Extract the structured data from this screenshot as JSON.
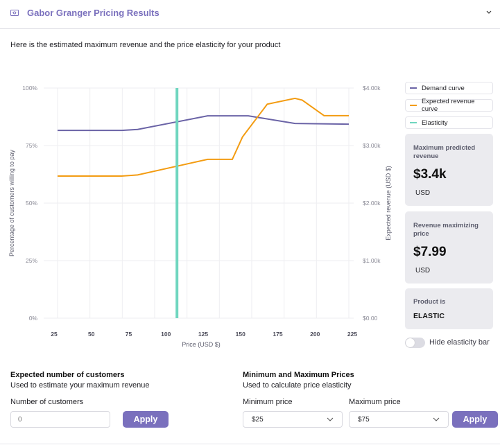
{
  "header": {
    "title": "Gabor Granger Pricing Results",
    "icon": "money-icon",
    "collapse_icon": "chevron-down-icon"
  },
  "intro_text": "Here is the estimated maximum revenue and the price elasticity for your product",
  "colors": {
    "brand": "#7a70bd",
    "demand": "#6a63a6",
    "revenue": "#f39c12",
    "elasticity": "#6fd6bf"
  },
  "chart_data": {
    "type": "line",
    "title": "",
    "xlabel": "Price (USD $)",
    "ylabel": "Percentage of customers willing to pay",
    "y2label": "Expected revenue (USD $)",
    "xlim": [
      25,
      225
    ],
    "ylim": [
      0,
      100
    ],
    "y2lim": [
      0,
      4000
    ],
    "x_ticks": [
      "25",
      "50",
      "75",
      "100",
      "125",
      "150",
      "175",
      "200",
      "225"
    ],
    "y_ticks": [
      "0%",
      "25%",
      "50%",
      "75%",
      "100%"
    ],
    "y2_ticks": [
      "$0.00",
      "$1.00k",
      "$2.00k",
      "$3.00k",
      "$4.00k"
    ],
    "grid": true,
    "legend": "right",
    "series": [
      {
        "name": "Demand curve",
        "axis": "left",
        "x": [
          25,
          69,
          80,
          128,
          156,
          188,
          225
        ],
        "values": [
          81.6,
          81.6,
          82.0,
          87.9,
          87.9,
          84.6,
          84.3
        ]
      },
      {
        "name": "Expected revenue curve",
        "axis": "right",
        "x": [
          25,
          69,
          80,
          128,
          145,
          152,
          169,
          188,
          193,
          208,
          225
        ],
        "values": [
          2470,
          2470,
          2490,
          2760,
          2760,
          3150,
          3720,
          3820,
          3790,
          3520,
          3520
        ]
      }
    ],
    "elasticity_bar": {
      "name": "Elasticity",
      "x": 107
    }
  },
  "legend": [
    {
      "label": "Demand curve",
      "color": "#6a63a6"
    },
    {
      "label": "Expected revenue curve",
      "color": "#f39c12"
    },
    {
      "label": "Elasticity",
      "color": "#6fd6bf"
    }
  ],
  "cards": {
    "max_revenue": {
      "label": "Maximum predicted revenue",
      "value": "$3.4k",
      "unit": "USD"
    },
    "max_price": {
      "label": "Revenue maximizing price",
      "value": "$7.99",
      "unit": "USD"
    },
    "elasticity": {
      "label": "Product is",
      "value": "ELASTIC"
    }
  },
  "toggle": {
    "label": "Hide elasticity bar",
    "checked": false
  },
  "customers_section": {
    "title": "Expected number of customers",
    "subtitle": "Used to estimate your maximum revenue",
    "field_label": "Number of customers",
    "placeholder": "0",
    "apply_label": "Apply"
  },
  "prices_section": {
    "title": "Minimum and Maximum Prices",
    "subtitle": "Used to calculate price elasticity",
    "min_label": "Minimum  price",
    "min_value": "$25",
    "max_label": "Maximum price",
    "max_value": "$75",
    "apply_label": "Apply"
  }
}
